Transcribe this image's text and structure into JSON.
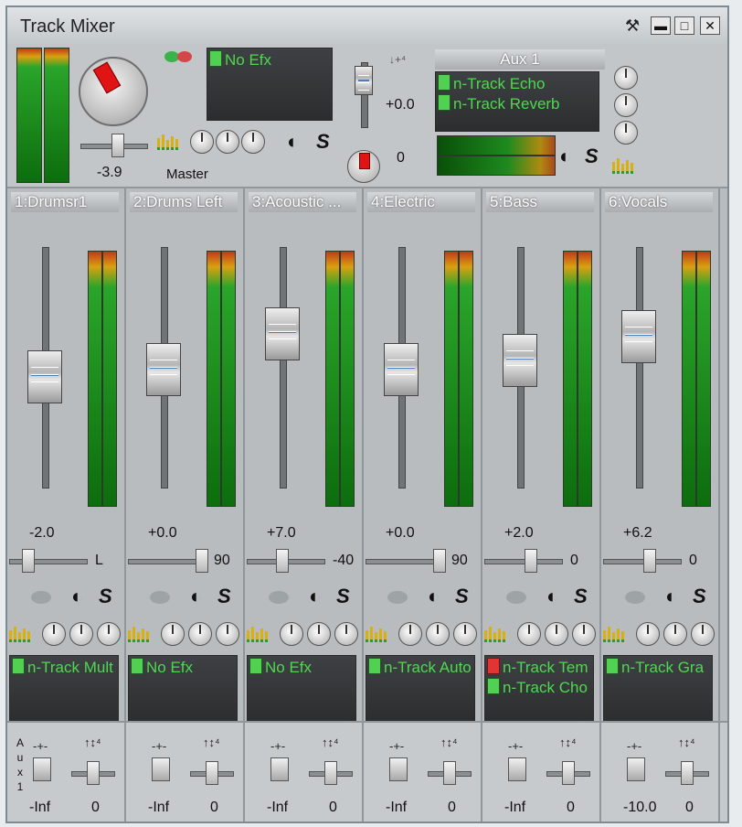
{
  "window": {
    "title": "Track Mixer",
    "buttons": [
      "minimize",
      "restore",
      "close"
    ]
  },
  "master": {
    "fx_items": [
      {
        "label": "No Efx",
        "led": "green"
      }
    ],
    "pan_value": "-3.9",
    "label": "Master",
    "volume_value": "+0.0",
    "aux_send_value": "0",
    "aux": {
      "name": "Aux 1",
      "fx_items": [
        {
          "label": "n-Track Echo",
          "led": "green"
        },
        {
          "label": "n-Track Reverb",
          "led": "green"
        }
      ]
    }
  },
  "channels": [
    {
      "name": "1:Drumsr1",
      "volume": "-2.0",
      "pan": "L",
      "pan_pos": 0.08,
      "fader_pos": 0.45,
      "fx": [
        {
          "label": "n-Track Mult",
          "led": "green"
        }
      ],
      "aux_send": "-Inf",
      "aux_pan": "0"
    },
    {
      "name": "2:Drums Left",
      "volume": "+0.0",
      "pan": "90",
      "pan_pos": 0.92,
      "fader_pos": 0.42,
      "fx": [
        {
          "label": "No Efx",
          "led": "green"
        }
      ],
      "aux_send": "-Inf",
      "aux_pan": "0"
    },
    {
      "name": "3:Acoustic ...",
      "volume": "+7.0",
      "pan": "-40",
      "pan_pos": 0.33,
      "fader_pos": 0.27,
      "fx": [
        {
          "label": "No Efx",
          "led": "green"
        }
      ],
      "aux_send": "-Inf",
      "aux_pan": "0"
    },
    {
      "name": "4:Electric",
      "volume": "+0.0",
      "pan": "90",
      "pan_pos": 0.92,
      "fader_pos": 0.42,
      "fx": [
        {
          "label": "n-Track Auto",
          "led": "green"
        }
      ],
      "aux_send": "-Inf",
      "aux_pan": "0"
    },
    {
      "name": "5:Bass",
      "volume": "+2.0",
      "pan": "0",
      "pan_pos": 0.5,
      "fader_pos": 0.38,
      "fx": [
        {
          "label": "n-Track Tem",
          "led": "red"
        },
        {
          "label": "n-Track Cho",
          "led": "green"
        }
      ],
      "aux_send": "-Inf",
      "aux_pan": "0"
    },
    {
      "name": "6:Vocals",
      "volume": "+6.2",
      "pan": "0",
      "pan_pos": 0.5,
      "fader_pos": 0.28,
      "fx": [
        {
          "label": "n-Track Gra",
          "led": "green"
        }
      ],
      "aux_send": "-10.0",
      "aux_pan": "0"
    }
  ],
  "aux_row_label": "A u x 1",
  "icons": {
    "mono": "speaker-icon",
    "solo": "solo-icon",
    "eq": "eq-icon",
    "tools": "hammer-icon"
  }
}
